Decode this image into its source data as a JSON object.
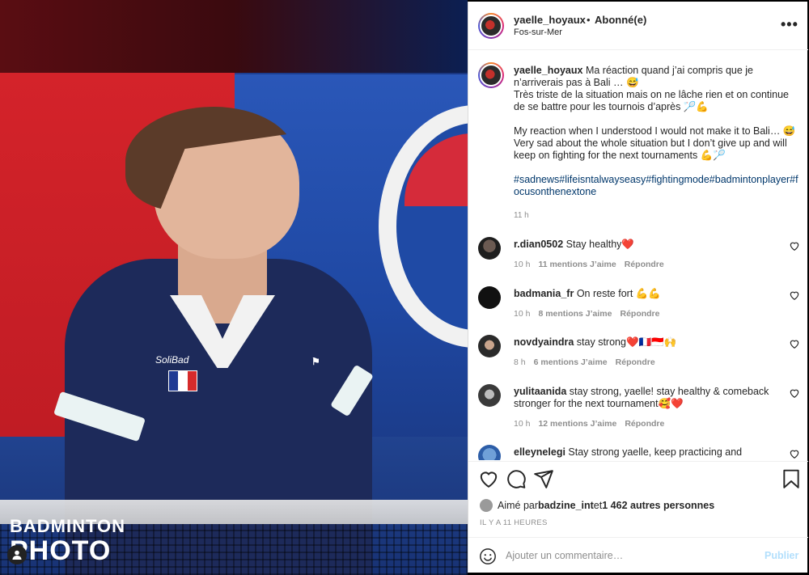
{
  "photo": {
    "watermark_line1": "BADMINTON",
    "watermark_line2": "PHOTO",
    "shirt_brand": "SoliBad",
    "flag_colors": [
      "#1f3a93",
      "#ffffff",
      "#d62b2b"
    ]
  },
  "post": {
    "username": "yaelle_hoyaux",
    "separator": "•",
    "follow_status": "Abonné(e)",
    "location": "Fos-sur-Mer",
    "more_label": "•••",
    "caption": {
      "username": "yaelle_hoyaux",
      "line1": " Ma réaction quand j’ai compris que je n’arriverais pas à Bali … 😅",
      "line2": "Très triste de la situation mais on ne lâche rien et on continue de se battre pour les tournois d’après 🏸💪",
      "line3": "My reaction when I understood I would not make it to Bali… 😅",
      "line4": "Very sad about the whole situation but I don’t give up and will keep on fighting for the next tournaments 💪🏸",
      "hashtags": "#sadnews#lifeisntalwayseasy#fightingmode#badmintonplayer#focusonthenextone",
      "time": "11 h"
    },
    "comments": [
      {
        "user": "r.dian0502",
        "text": " Stay healthy❤️",
        "time": "10 h",
        "likes": "11 mentions J’aime",
        "reply": "Répondre"
      },
      {
        "user": "badmania_fr",
        "text": " On reste fort 💪💪",
        "time": "10 h",
        "likes": "8 mentions J’aime",
        "reply": "Répondre"
      },
      {
        "user": "novdyaindra",
        "text": " stay strong❤️🇫🇷🇮🇩🙌",
        "time": "8 h",
        "likes": "6 mentions J’aime",
        "reply": "Répondre"
      },
      {
        "user": "yulitaanida",
        "text": " stay strong, yaelle! stay healthy & comeback stronger for the next tournament🥰❤️",
        "time": "10 h",
        "likes": "12 mentions J’aime",
        "reply": "Répondre"
      },
      {
        "user": "elleynelegi",
        "text": " Stay strong yaelle, keep practicing and",
        "time": "",
        "likes": "",
        "reply": ""
      }
    ],
    "likes": {
      "prefix": "Aimé par ",
      "user": "badzine_int",
      "middle": " et ",
      "others": "1 462 autres personnes"
    },
    "ago": "IL Y A 11 HEURES",
    "add_comment_placeholder": "Ajouter un commentaire…",
    "publish_label": "Publier"
  },
  "colors": {
    "link": "#00376b",
    "muted": "#8e8e8e",
    "publish_disabled": "#b2dffc",
    "heart_red": "#ed4956"
  },
  "icons": [
    "heart-icon",
    "comment-icon",
    "share-icon",
    "bookmark-icon",
    "emoji-icon",
    "more-icon",
    "person-icon"
  ]
}
